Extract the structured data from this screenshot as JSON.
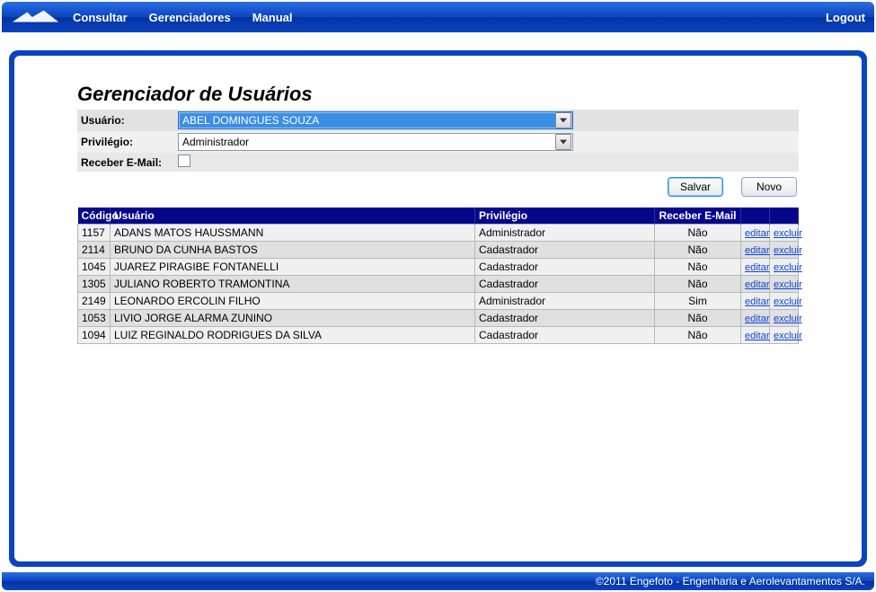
{
  "nav": {
    "links": [
      "Consultar",
      "Gerenciadores",
      "Manual"
    ],
    "logout": "Logout"
  },
  "page": {
    "title": "Gerenciador de Usuários"
  },
  "form": {
    "usuario_label": "Usuário:",
    "usuario_value": "ABEL DOMINGUES SOUZA",
    "privilegio_label": "Privilégio:",
    "privilegio_value": "Administrador",
    "receber_label": "Receber E-Mail:",
    "receber_checked": false
  },
  "buttons": {
    "save": "Salvar",
    "new": "Novo"
  },
  "table": {
    "headers": {
      "codigo": "Código",
      "usuario": "Usuário",
      "privilegio": "Privilégio",
      "receber": "Receber E-Mail",
      "editar": "",
      "excluir": ""
    },
    "action_edit": "editar",
    "action_delete": "excluir",
    "rows": [
      {
        "codigo": "1157",
        "usuario": "ADANS MATOS HAUSSMANN",
        "privilegio": "Administrador",
        "receber": "Não"
      },
      {
        "codigo": "2114",
        "usuario": "BRUNO DA CUNHA BASTOS",
        "privilegio": "Cadastrador",
        "receber": "Não"
      },
      {
        "codigo": "1045",
        "usuario": "JUAREZ PIRAGIBE FONTANELLI",
        "privilegio": "Cadastrador",
        "receber": "Não"
      },
      {
        "codigo": "1305",
        "usuario": "JULIANO ROBERTO TRAMONTINA",
        "privilegio": "Cadastrador",
        "receber": "Não"
      },
      {
        "codigo": "2149",
        "usuario": "LEONARDO ERCOLIN FILHO",
        "privilegio": "Administrador",
        "receber": "Sim"
      },
      {
        "codigo": "1053",
        "usuario": "LIVIO JORGE ALARMA ZUNINO",
        "privilegio": "Cadastrador",
        "receber": "Não"
      },
      {
        "codigo": "1094",
        "usuario": "LUIZ REGINALDO RODRIGUES DA SILVA",
        "privilegio": "Cadastrador",
        "receber": "Não"
      }
    ]
  },
  "footer": {
    "text": "©2011 Engefoto - Engenharia e Aerolevantamentos S/A."
  }
}
